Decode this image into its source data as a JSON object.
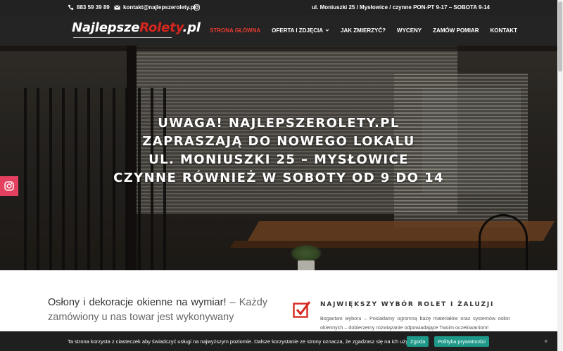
{
  "topbar": {
    "phone": "883 59 39 89",
    "email": "kontakt@najlepszerolety.pl",
    "address": "ul. Moniuszki 25 / Mysłowice / czynne PON-PT 9-17 – SOBOTA 9-14"
  },
  "header": {
    "logo_main": "Najlepsze",
    "logo_accent": "Rolety",
    "logo_suffix": ".pl"
  },
  "nav": [
    {
      "label": "STRONA GŁÓWNA",
      "active": true
    },
    {
      "label": "OFERTA I ZDJĘCIA",
      "dropdown": true
    },
    {
      "label": "JAK ZMIERZYĆ?"
    },
    {
      "label": "WYCENY"
    },
    {
      "label": "ZAMÓW POMIAR"
    },
    {
      "label": "KONTAKT"
    }
  ],
  "hero": {
    "line1": "UWAGA! NAJLEPSZEROLETY.PL",
    "line2": "ZAPRASZAJĄ DO NOWEGO LOKALU",
    "line3": "UL. MONIUSZKI 25 – MYSŁOWICE",
    "line4": "CZYNNE RÓWNIEŻ W SOBOTY OD 9 DO 14"
  },
  "intro": {
    "lead": "Osłony i dekoracje okienne na wymiar!",
    "rest": " – Każdy zamówiony u nas towar jest wykonywany"
  },
  "feature": {
    "title": "NAJWIĘKSZY WYBÓR ROLET I ŻALUZJI",
    "desc": "Bogactwo wyboru – Posiadamy ogromną bazę materiałów oraz systemów osłon okiennych – dobierzemy rozwiązanie odpowiadające Twoim oczekiwaniom!"
  },
  "cookie": {
    "text": "Ta strona korzysta z ciasteczek aby świadczyć usługi na najwyższym poziomie. Dalsze korzystanie ze strony oznacza, że zgadzasz się na ich użycie.",
    "accept": "Zgoda",
    "privacy": "Polityka prywatności",
    "close": "×"
  },
  "colors": {
    "accent": "#e53b2f",
    "header_bg": "#242424",
    "cookie_btn": "#1f9a8a",
    "instagram": "#e4405f"
  },
  "icons": [
    "phone-icon",
    "mail-icon",
    "instagram-icon",
    "chevron-down-icon",
    "checkbox-icon",
    "close-icon"
  ]
}
